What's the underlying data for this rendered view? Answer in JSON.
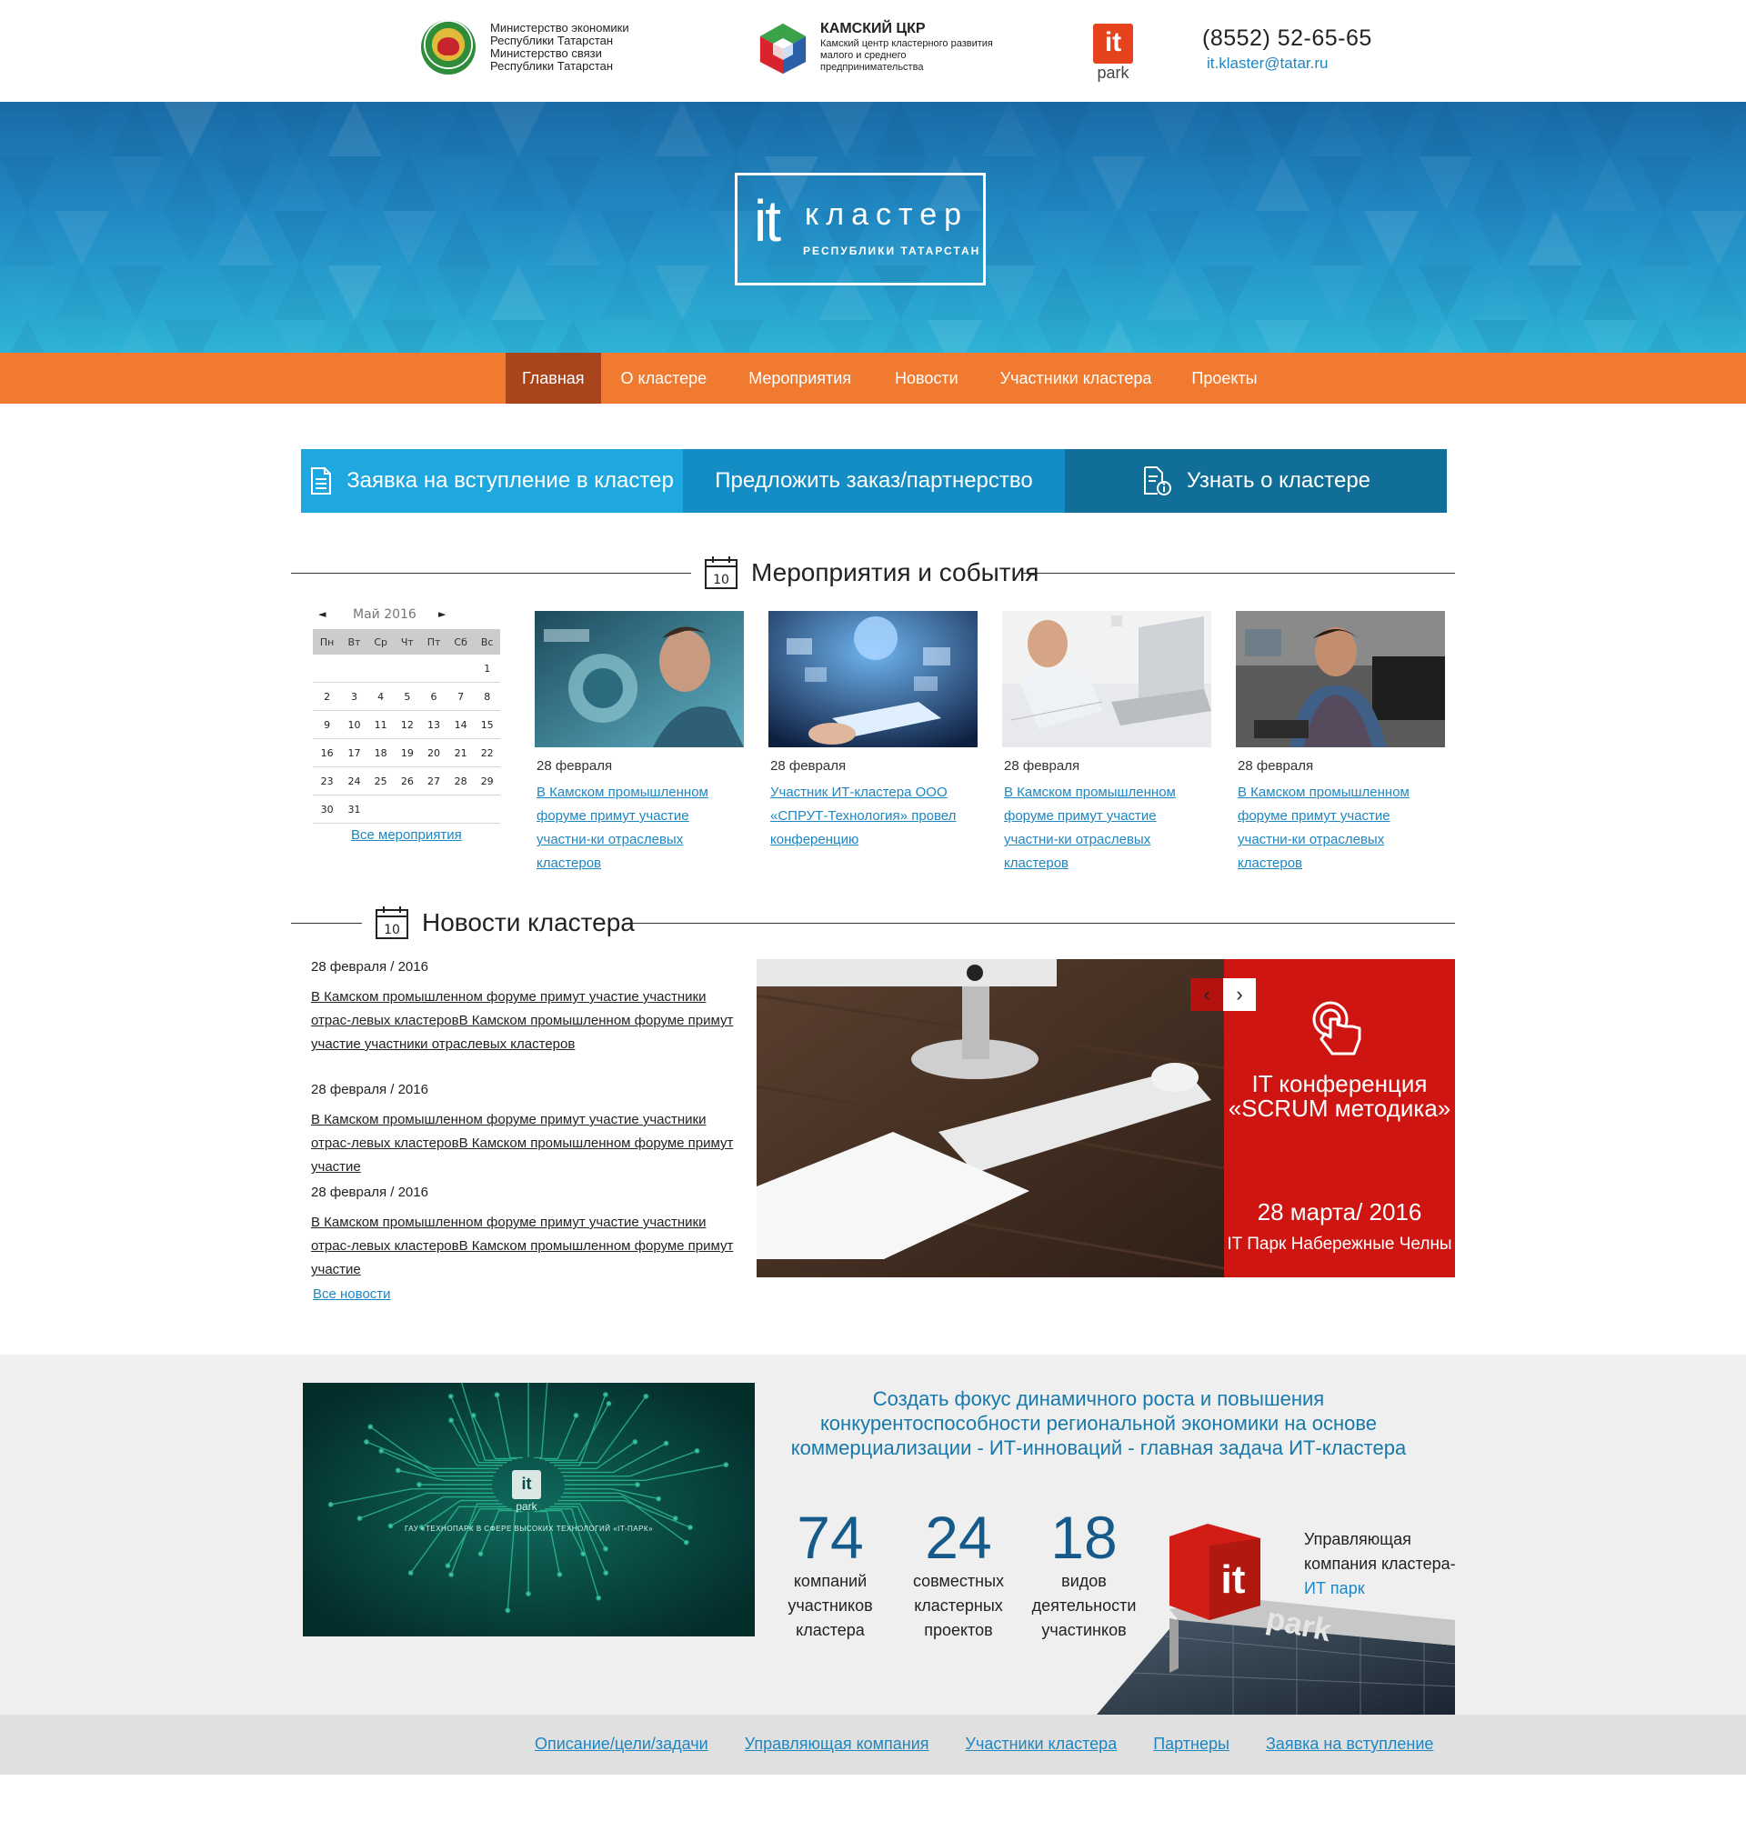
{
  "header": {
    "ministry_lines": [
      "Министерство экономики",
      "Республики Татарстан",
      "Министерство связи",
      "Республики Татарстан"
    ],
    "kckr_title": "КАМСКИЙ ЦКР",
    "kckr_lines": [
      "Камский центр кластерного развития",
      "малого и среднего",
      "предпринимательства"
    ],
    "itpark_logo_it": "it",
    "itpark_logo_park": "park",
    "phone": "(8552) 52-65-65",
    "email": "it.klaster@tatar.ru"
  },
  "banner": {
    "logo_it": "it",
    "logo_title": "кластер",
    "logo_subtitle": "РЕСПУБЛИКИ ТАТАРСТАН"
  },
  "nav": {
    "items": [
      {
        "label": "Главная"
      },
      {
        "label": "О кластере"
      },
      {
        "label": "Мероприятия"
      },
      {
        "label": "Новости"
      },
      {
        "label": "Участники кластера"
      },
      {
        "label": "Проекты"
      }
    ]
  },
  "cta": {
    "apply": "Заявка на вступление в кластер",
    "offer": "Предложить заказ/партнерство",
    "learn": "Узнать о кластере"
  },
  "events_section": {
    "title": "Мероприятия и события",
    "icon_day": "10",
    "calendar": {
      "prev": "◄",
      "next": "►",
      "month": "Май 2016",
      "weekdays": [
        "Пн",
        "Вт",
        "Ср",
        "Чт",
        "Пт",
        "Сб",
        "Вс"
      ],
      "weeks": [
        [
          "",
          "",
          "",
          "",
          "",
          "",
          "1"
        ],
        [
          "2",
          "3",
          "4",
          "5",
          "6",
          "7",
          "8"
        ],
        [
          "9",
          "10",
          "11",
          "12",
          "13",
          "14",
          "15"
        ],
        [
          "16",
          "17",
          "18",
          "19",
          "20",
          "21",
          "22"
        ],
        [
          "23",
          "24",
          "25",
          "26",
          "27",
          "28",
          "29"
        ],
        [
          "30",
          "31",
          "",
          "",
          "",
          "",
          ""
        ]
      ]
    },
    "all_link": "Все мероприятия",
    "items": [
      {
        "date": "28 февраля",
        "text": "В Камском промышленном форуме примут участие участни-ки отраслевых кластеров"
      },
      {
        "date": "28 февраля",
        "text": "Участник ИТ-кластера ООО «СПРУТ-Технология» провел конференцию"
      },
      {
        "date": "28 февраля",
        "text": "В Камском промышленном форуме примут участие участни-ки отраслевых кластеров"
      },
      {
        "date": "28 февраля",
        "text": "В Камском промышленном форуме примут участие участни-ки отраслевых кластеров"
      }
    ]
  },
  "news_section": {
    "title": "Новости кластера",
    "icon_day": "10",
    "items": [
      {
        "date": "28 февраля / 2016",
        "text": "В Камском промышленном форуме примут участие участники отрас-левых кластеровВ Камском промышленном форуме примут участие участники отраслевых кластеров"
      },
      {
        "date": "28 февраля / 2016",
        "text": "В Камском промышленном форуме примут участие участники отрас-левых кластеровВ Камском промышленном форуме примут участие"
      },
      {
        "date": "28 февраля / 2016",
        "text": "В Камском промышленном форуме примут участие участники отрас-левых кластеровВ Камском промышленном форуме примут участие"
      }
    ],
    "all_link": "Все новости",
    "promo": {
      "title": "IT конференция «SCRUM методика»",
      "date": "28 марта/ 2016",
      "place": "IT Парк Набережные Челны",
      "prev": "‹",
      "next": "›"
    }
  },
  "about": {
    "video_caption": "ГАУ «ТЕХНОПАРК В СФЕРЕ ВЫСОКИХ ТЕХНОЛОГИЙ «IT-ПАРК»",
    "video_logo_it": "it",
    "video_logo_park": "park",
    "mission": "Создать фокус динамичного роста и повышения конкурентоспособности региональной экономики на основе коммерциализации - ИТ-инноваций - главная задача ИТ-кластера",
    "stats": [
      {
        "value": "74",
        "label": "компаний участников кластера"
      },
      {
        "value": "24",
        "label": "совместных кластерных проектов"
      },
      {
        "value": "18",
        "label": "видов деятельности участинков"
      }
    ],
    "manager_text": "Управляющая компания кластера-",
    "manager_link": "ИТ парк",
    "building_sign_it": "it",
    "building_sign_park": "park"
  },
  "footer": {
    "links": [
      "Описание/цели/задачи",
      "Управляющая компания",
      "Участники кластера",
      "Партнеры",
      "Заявка на вступление"
    ]
  },
  "colors": {
    "nav_orange": "#f07a30",
    "nav_active": "#a9441b",
    "link_blue": "#1e86c0",
    "promo_red": "#cf1511"
  }
}
